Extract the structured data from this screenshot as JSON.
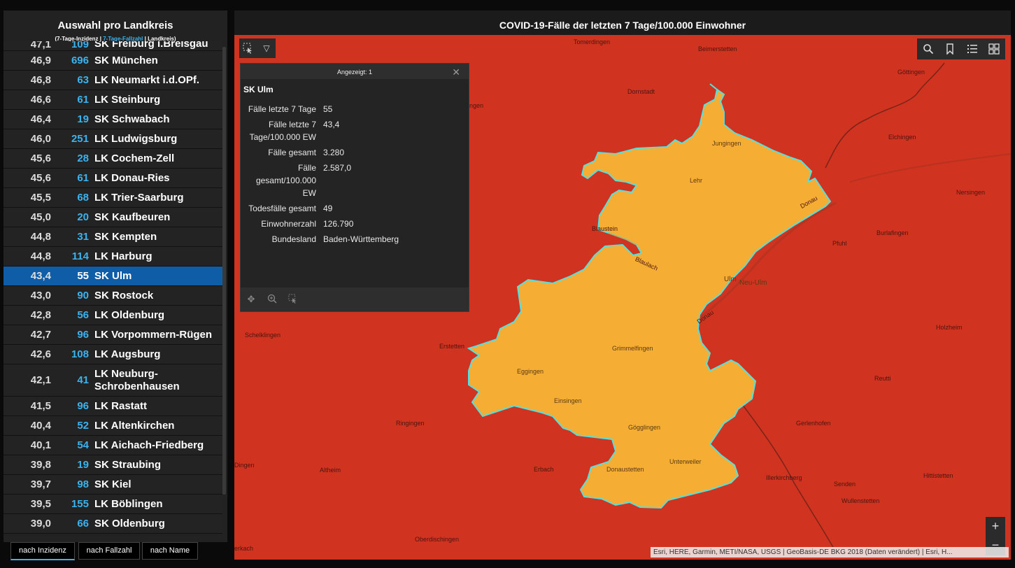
{
  "left_panel": {
    "title": "Auswahl pro Landkreis",
    "subtitle_part1": "(7-Tage-Inzidenz | ",
    "subtitle_part2": "7-Tage-Fallzahl",
    "subtitle_part3": " | Landkreis)",
    "rows": [
      {
        "inc": "47,1",
        "cnt": "109",
        "name": "SK Freiburg i.Breisgau"
      },
      {
        "inc": "46,9",
        "cnt": "696",
        "name": "SK München"
      },
      {
        "inc": "46,8",
        "cnt": "63",
        "name": "LK Neumarkt i.d.OPf."
      },
      {
        "inc": "46,6",
        "cnt": "61",
        "name": "LK Steinburg"
      },
      {
        "inc": "46,4",
        "cnt": "19",
        "name": "SK Schwabach"
      },
      {
        "inc": "46,0",
        "cnt": "251",
        "name": "LK Ludwigsburg"
      },
      {
        "inc": "45,6",
        "cnt": "28",
        "name": "LK Cochem-Zell"
      },
      {
        "inc": "45,6",
        "cnt": "61",
        "name": "LK Donau-Ries"
      },
      {
        "inc": "45,5",
        "cnt": "68",
        "name": "LK Trier-Saarburg"
      },
      {
        "inc": "45,0",
        "cnt": "20",
        "name": "SK Kaufbeuren"
      },
      {
        "inc": "44,8",
        "cnt": "31",
        "name": "SK Kempten"
      },
      {
        "inc": "44,8",
        "cnt": "114",
        "name": "LK Harburg"
      },
      {
        "inc": "43,4",
        "cnt": "55",
        "name": "SK Ulm",
        "selected": true
      },
      {
        "inc": "43,0",
        "cnt": "90",
        "name": "SK Rostock"
      },
      {
        "inc": "42,8",
        "cnt": "56",
        "name": "LK Oldenburg"
      },
      {
        "inc": "42,7",
        "cnt": "96",
        "name": "LK Vorpommern-Rügen"
      },
      {
        "inc": "42,6",
        "cnt": "108",
        "name": "LK Augsburg"
      },
      {
        "inc": "42,1",
        "cnt": "41",
        "name": "LK Neuburg-Schrobenhausen"
      },
      {
        "inc": "41,5",
        "cnt": "96",
        "name": "LK Rastatt"
      },
      {
        "inc": "40,4",
        "cnt": "52",
        "name": "LK Altenkirchen"
      },
      {
        "inc": "40,1",
        "cnt": "54",
        "name": "LK Aichach-Friedberg"
      },
      {
        "inc": "39,8",
        "cnt": "19",
        "name": "SK Straubing"
      },
      {
        "inc": "39,7",
        "cnt": "98",
        "name": "SK Kiel"
      },
      {
        "inc": "39,5",
        "cnt": "155",
        "name": "LK Böblingen"
      },
      {
        "inc": "39,0",
        "cnt": "66",
        "name": "SK Oldenburg"
      }
    ],
    "tabs": [
      "nach Inzidenz",
      "nach Fallzahl",
      "nach Name"
    ]
  },
  "map": {
    "title": "COVID-19-Fälle der letzten 7 Tage/100.000 Einwohner",
    "colors": {
      "background": "#d0331f",
      "district_fill": "#f6ad34",
      "district_outline": "#54e0de"
    },
    "popup": {
      "header": "Angezeigt: 1",
      "title": "SK Ulm",
      "fields": [
        {
          "label": "Fälle letzte 7 Tage",
          "value": "55"
        },
        {
          "label": "Fälle letzte 7 Tage/100.000 EW",
          "value": "43,4"
        },
        {
          "label": "Fälle gesamt",
          "value": "3.280"
        },
        {
          "label": "Fälle gesamt/100.000 EW",
          "value": "2.587,0"
        },
        {
          "label": "Todesfälle gesamt",
          "value": "49"
        },
        {
          "label": "Einwohnerzahl",
          "value": "126.790"
        },
        {
          "label": "Bundesland",
          "value": "Baden-Württemberg"
        }
      ]
    },
    "places": [
      "Tomerdingen",
      "Beimerstetten",
      "Göttingen",
      "Dornstadt",
      "ingen",
      "Elchingen",
      "Jungingen",
      "Lehr",
      "Nersingen",
      "Blaustein",
      "Burlafingen",
      "Pfuhl",
      "Ulm",
      "Neu-Ulm",
      "Schelklingen",
      "Erstetten",
      "Grimmelfingen",
      "Holzheim",
      "Eggingen",
      "Reutti",
      "Einsingen",
      "Ringingen",
      "Gerlenhofen",
      "Gögglingen",
      "Dingen",
      "Altheim",
      "Erbach",
      "Donaustetten",
      "Unterweiler",
      "Illerkirchberg",
      "Senden",
      "Hittistetten",
      "Wullenstetten",
      "Oberdischingen",
      "erkach",
      "Donau",
      "Donau",
      "Blaulach"
    ],
    "attribution": "Esri, HERE, Garmin, METI/NASA, USGS | GeoBasis-DE BKG 2018 (Daten verändert) | Esri, H..."
  }
}
